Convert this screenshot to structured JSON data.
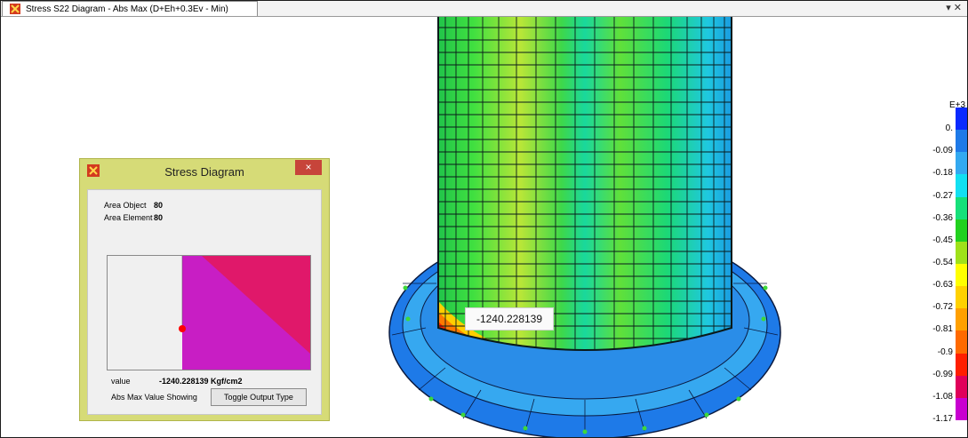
{
  "window": {
    "tab_title": "Stress S22 Diagram - Abs Max  (D+Eh+0.3Ev - Min)",
    "controls": "▾ ✕"
  },
  "tooltip": {
    "value": "-1240.228139"
  },
  "legend": {
    "exponent": "E+3",
    "labels": [
      "0.",
      "-0.09",
      "-0.18",
      "-0.27",
      "-0.36",
      "-0.45",
      "-0.54",
      "-0.63",
      "-0.72",
      "-0.81",
      "-0.9",
      "-0.99",
      "-1.08",
      "-1.17"
    ],
    "colors": [
      "#0a2aff",
      "#1e7ae8",
      "#33a9f0",
      "#12e0f2",
      "#16e07a",
      "#21d11e",
      "#9fe11a",
      "#ffff00",
      "#ffd100",
      "#ffa000",
      "#ff6a00",
      "#ff1f00",
      "#e0005a",
      "#c800d0"
    ]
  },
  "dialog": {
    "title": "Stress Diagram",
    "close": "×",
    "area_object_label": "Area Object",
    "area_object_value": "80",
    "area_element_label": "Area Element",
    "area_element_value": "80",
    "value_label": "value",
    "value": "-1240.228139  Kgf/cm2",
    "abs_max_text": "Abs Max Value Showing",
    "toggle_button": "Toggle Output Type",
    "preview_colors": {
      "magenta": "#c81ec4",
      "crimson": "#e0186a",
      "point": "#ff0000"
    }
  }
}
